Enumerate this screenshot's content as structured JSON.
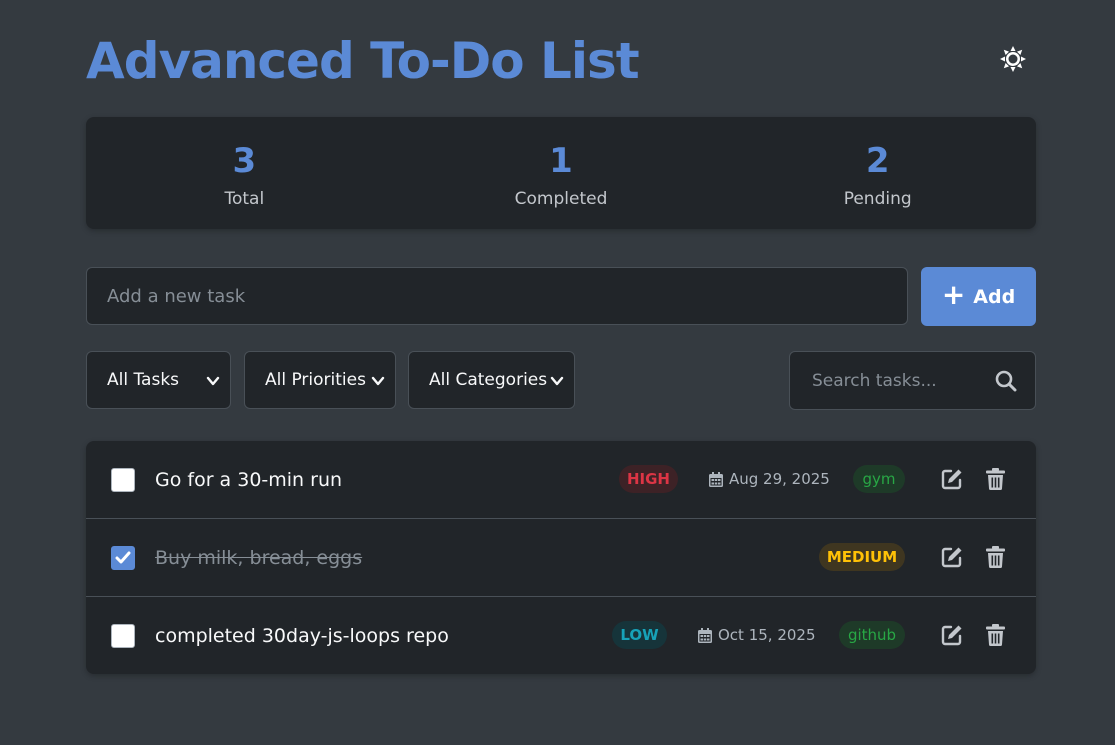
{
  "app": {
    "title": "Advanced To-Do List",
    "theme_icon": "sun-icon"
  },
  "stats": {
    "total": {
      "value": "3",
      "label": "Total"
    },
    "completed": {
      "value": "1",
      "label": "Completed"
    },
    "pending": {
      "value": "2",
      "label": "Pending"
    }
  },
  "input": {
    "placeholder": "Add a new task",
    "value": ""
  },
  "add_button": {
    "icon": "plus-icon",
    "label": "Add"
  },
  "filters": {
    "status": {
      "selected": "All Tasks"
    },
    "priority": {
      "selected": "All Priorities"
    },
    "category": {
      "selected": "All Categories"
    }
  },
  "search": {
    "placeholder": "Search tasks...",
    "value": "",
    "icon": "search-icon"
  },
  "tasks": [
    {
      "text": "Go for a 30-min run",
      "completed": false,
      "priority": "HIGH",
      "date": "Aug 29, 2025",
      "category": "gym"
    },
    {
      "text": "Buy milk, bread, eggs",
      "completed": true,
      "priority": "MEDIUM"
    },
    {
      "text": "completed 30day-js-loops repo",
      "completed": false,
      "priority": "LOW",
      "date": "Oct 15, 2025",
      "category": "github"
    }
  ],
  "colors": {
    "background": "#343a40",
    "card": "#212529",
    "accent": "#5b8ad6",
    "high": "#dc3545",
    "medium": "#ffc107",
    "low": "#17a2b8",
    "category": "#28a745"
  }
}
